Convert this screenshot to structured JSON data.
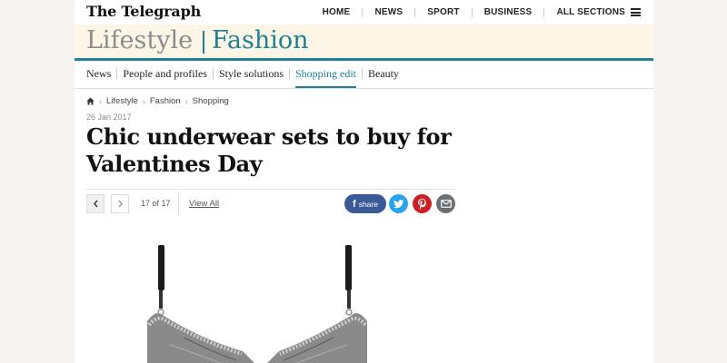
{
  "header": {
    "logo": "The Telegraph",
    "nav": [
      "HOME",
      "NEWS",
      "SPORT",
      "BUSINESS",
      "ALL SECTIONS"
    ]
  },
  "section": {
    "parent": "Lifestyle",
    "name": "Fashion"
  },
  "subnav": {
    "items": [
      "News",
      "People and profiles",
      "Style solutions",
      "Shopping edit",
      "Beauty"
    ],
    "active": "Shopping edit"
  },
  "breadcrumb": [
    "Lifestyle",
    "Fashion",
    "Shopping"
  ],
  "article": {
    "date": "26 Jan 2017",
    "title": "Chic underwear sets to buy for Valentines Day"
  },
  "gallery": {
    "counter": "17 of 17",
    "view_all": "View All",
    "share_label": "share"
  },
  "icons": [
    "home-icon",
    "chevron-left-icon",
    "chevron-right-icon",
    "facebook-icon",
    "twitter-icon",
    "pinterest-icon",
    "email-icon",
    "menu-icon"
  ],
  "colors": {
    "accent": "#1c8193",
    "band": "#fdf5e6",
    "facebook": "#3b5998",
    "twitter": "#2aa3ef",
    "pinterest": "#cb1f27",
    "email": "#6c7075"
  }
}
